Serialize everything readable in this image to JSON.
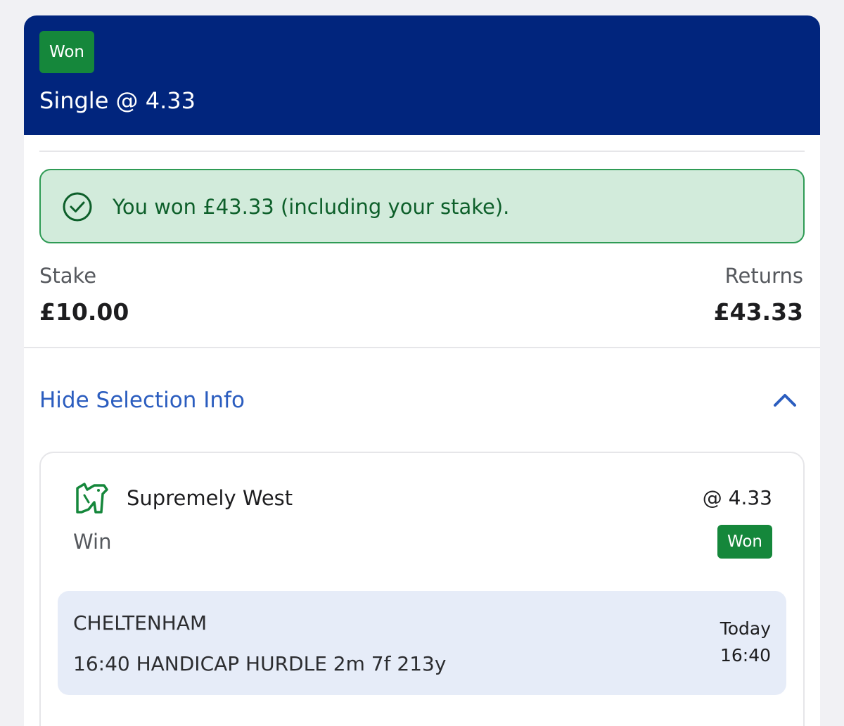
{
  "bet": {
    "status": "Won",
    "title": "Single @ 4.33"
  },
  "banner": {
    "icon": "check-circle-icon",
    "message": "You won £43.33 (including your stake)."
  },
  "summary": {
    "stake_label": "Stake",
    "stake_value": "£10.00",
    "returns_label": "Returns",
    "returns_value": "£43.33"
  },
  "toggle": {
    "label": "Hide Selection Info",
    "icon": "chevron-up-icon"
  },
  "selection": {
    "icon": "horse-racing-icon",
    "name": "Supremely West",
    "odds": "@ 4.33",
    "market": "Win",
    "status": "Won",
    "event": {
      "venue": "CHELTENHAM",
      "race": "16:40 HANDICAP HURDLE 2m 7f 213y",
      "day": "Today",
      "time": "16:40"
    }
  },
  "colors": {
    "header_bg": "#01257d",
    "won_badge": "#15873b",
    "banner_bg": "#d2ebdb",
    "banner_border": "#2f9b55",
    "link": "#2b5dbf",
    "event_bg": "#e6ecf8"
  }
}
